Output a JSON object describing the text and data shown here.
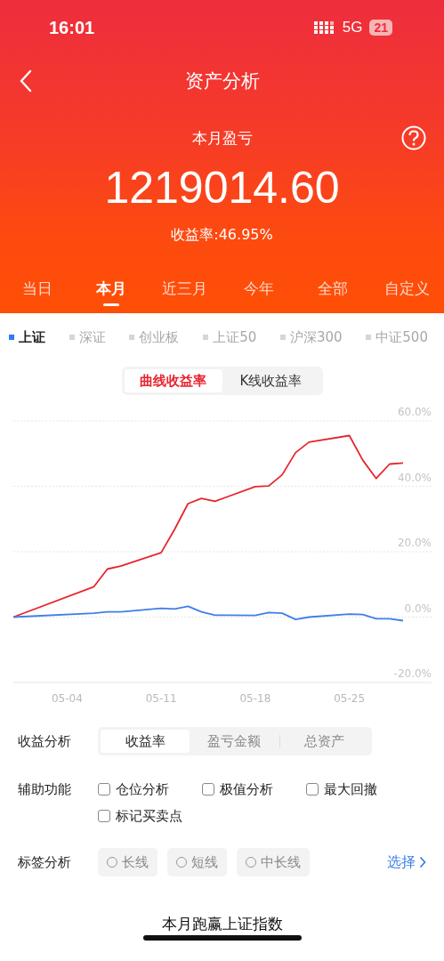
{
  "status_bar": {
    "time": "16:01",
    "network": "5G",
    "battery": "21"
  },
  "nav": {
    "title": "资产分析"
  },
  "summary": {
    "label": "本月盈亏",
    "amount": "1219014.60",
    "rate": "收益率:46.95%"
  },
  "period_tabs": [
    {
      "label": "当日",
      "selected": false
    },
    {
      "label": "本月",
      "selected": true
    },
    {
      "label": "近三月",
      "selected": false
    },
    {
      "label": "今年",
      "selected": false
    },
    {
      "label": "全部",
      "selected": false
    },
    {
      "label": "自定义",
      "selected": false
    }
  ],
  "index_legend": [
    {
      "label": "上证",
      "selected": true
    },
    {
      "label": "深证",
      "selected": false
    },
    {
      "label": "创业板",
      "selected": false
    },
    {
      "label": "上证50",
      "selected": false
    },
    {
      "label": "沪深300",
      "selected": false
    },
    {
      "label": "中证500",
      "selected": false
    }
  ],
  "chart_modes": [
    {
      "label": "曲线收益率",
      "selected": true
    },
    {
      "label": "K线收益率",
      "selected": false
    }
  ],
  "chart": {
    "chart_data": {
      "type": "line",
      "categories": [
        null,
        null,
        null,
        null,
        "05-04",
        null,
        null,
        null,
        null,
        null,
        null,
        "05-11",
        null,
        null,
        null,
        null,
        null,
        null,
        "05-18",
        null,
        null,
        null,
        null,
        null,
        null,
        "05-25",
        null,
        null,
        null,
        null
      ],
      "series": [
        {
          "color": "#e8252f",
          "values": [
            0,
            null,
            null,
            null,
            null,
            null,
            9.3,
            14.7,
            15.6,
            null,
            null,
            19.7,
            26.8,
            34.7,
            36.3,
            35.4,
            null,
            null,
            39.9,
            40.1,
            43.5,
            50.3,
            53.5,
            null,
            null,
            55.5,
            48.0,
            42.4,
            46.8,
            47.1
          ]
        },
        {
          "color": "#3f7fe6",
          "values": [
            0,
            null,
            null,
            null,
            null,
            null,
            1.2,
            1.6,
            1.6,
            null,
            null,
            2.7,
            2.5,
            3.3,
            1.6,
            0.6,
            null,
            null,
            0.5,
            1.4,
            1.2,
            -0.7,
            0,
            null,
            null,
            0.9,
            0.8,
            -0.5,
            -0.5,
            -1.1
          ]
        }
      ],
      "ylim": [
        -20,
        60
      ],
      "grid": true,
      "yticks": [
        {
          "value": -20,
          "label": "-20.0%"
        },
        {
          "value": 0,
          "label": "0.0%"
        },
        {
          "value": 20,
          "label": "20.0%"
        },
        {
          "value": 40,
          "label": "40.0%"
        },
        {
          "value": 60,
          "label": "60.0%"
        }
      ]
    }
  },
  "profit_analysis": {
    "label": "收益分析",
    "options": [
      {
        "label": "收益率",
        "selected": true
      },
      {
        "label": "盈亏金额",
        "selected": false
      },
      {
        "label": "总资产",
        "selected": false
      }
    ]
  },
  "aux_functions": {
    "label": "辅助功能",
    "options": [
      {
        "label": "仓位分析",
        "checked": false
      },
      {
        "label": "极值分析",
        "checked": false
      },
      {
        "label": "最大回撤",
        "checked": false
      },
      {
        "label": "标记买卖点",
        "checked": false
      }
    ]
  },
  "tag_analysis": {
    "label": "标签分析",
    "options": [
      {
        "label": "长线",
        "selected": false
      },
      {
        "label": "短线",
        "selected": false
      },
      {
        "label": "中长线",
        "selected": false
      }
    ],
    "link": "选择"
  },
  "footer": {
    "title": "本月跑赢上证指数"
  }
}
